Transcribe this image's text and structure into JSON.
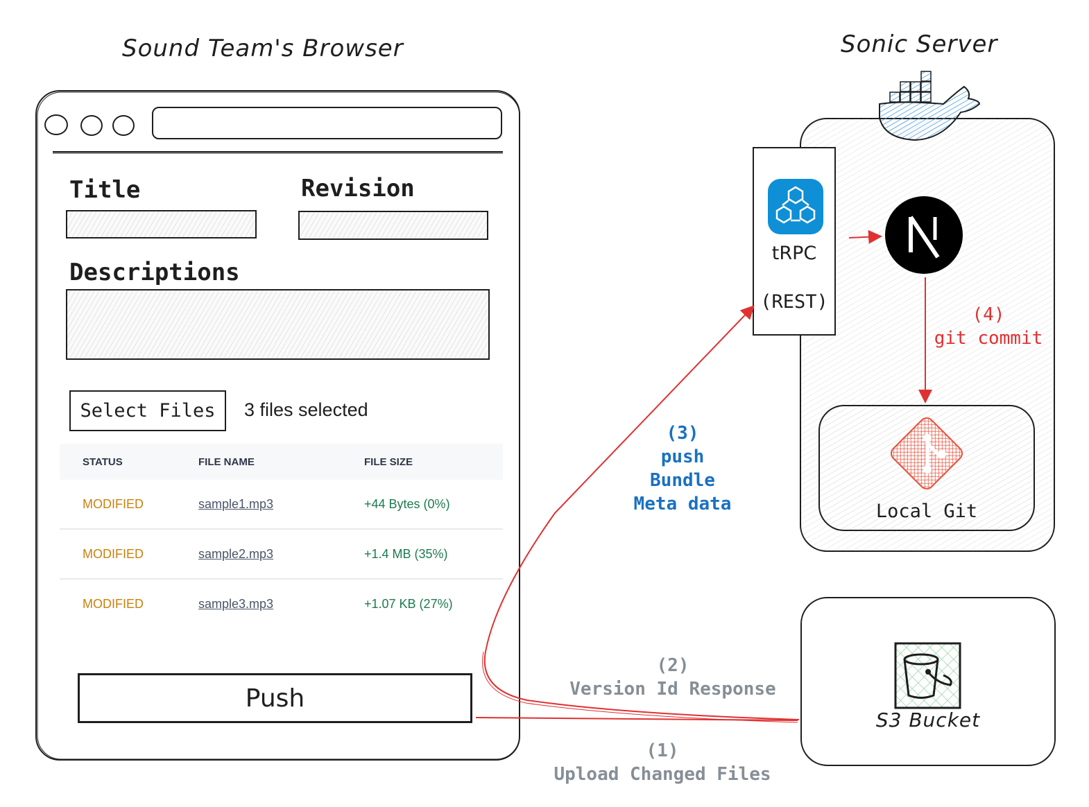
{
  "titles": {
    "browser": "Sound Team's Browser",
    "server": "Sonic Server"
  },
  "browser": {
    "window_controls": [
      "circle",
      "circle",
      "circle"
    ],
    "address_bar_value": "",
    "form": {
      "title_label": "Title",
      "title_value": "",
      "revision_label": "Revision",
      "revision_value": "",
      "descriptions_label": "Descriptions",
      "descriptions_value": ""
    },
    "select_files_button": "Select Files",
    "files_selected_text": "3 files selected",
    "table": {
      "headers": [
        "STATUS",
        "FILE NAME",
        "FILE SIZE"
      ],
      "rows": [
        {
          "status": "MODIFIED",
          "file_name": "sample1.mp3",
          "file_size": "+44 Bytes (0%)"
        },
        {
          "status": "MODIFIED",
          "file_name": "sample2.mp3",
          "file_size": "+1.4 MB (35%)"
        },
        {
          "status": "MODIFIED",
          "file_name": "sample3.mp3",
          "file_size": "+1.07 KB (27%)"
        }
      ]
    },
    "push_button": "Push"
  },
  "server": {
    "container_icon": "docker-whale-icon",
    "api": {
      "icon": "trpc-cubes-icon",
      "name": "tRPC",
      "subtitle": "(REST)"
    },
    "framework_icon": "nextjs-icon",
    "git": {
      "icon": "git-logo-icon",
      "label": "Local Git"
    }
  },
  "storage": {
    "icon": "s3-bucket-icon",
    "label": "S3 Bucket"
  },
  "steps": {
    "step1": {
      "number": "(1)",
      "text": "Upload Changed Files"
    },
    "step2": {
      "number": "(2)",
      "text": "Version Id Response"
    },
    "step3": {
      "number": "(3)",
      "lines": [
        "push",
        "Bundle",
        "Meta data"
      ]
    },
    "step4": {
      "number": "(4)",
      "text": "git commit"
    }
  },
  "colors": {
    "arrow": "#e03131",
    "step3_text": "#1971c2",
    "step_gray": "#868e96",
    "status_modified": "#c9810f",
    "file_size_positive": "#1c7a4f",
    "trpc_blue": "#0f8fd6",
    "docker_blue": "#4a9fe0",
    "git_red": "#e8503a",
    "s3_green": "#8fd49c"
  }
}
